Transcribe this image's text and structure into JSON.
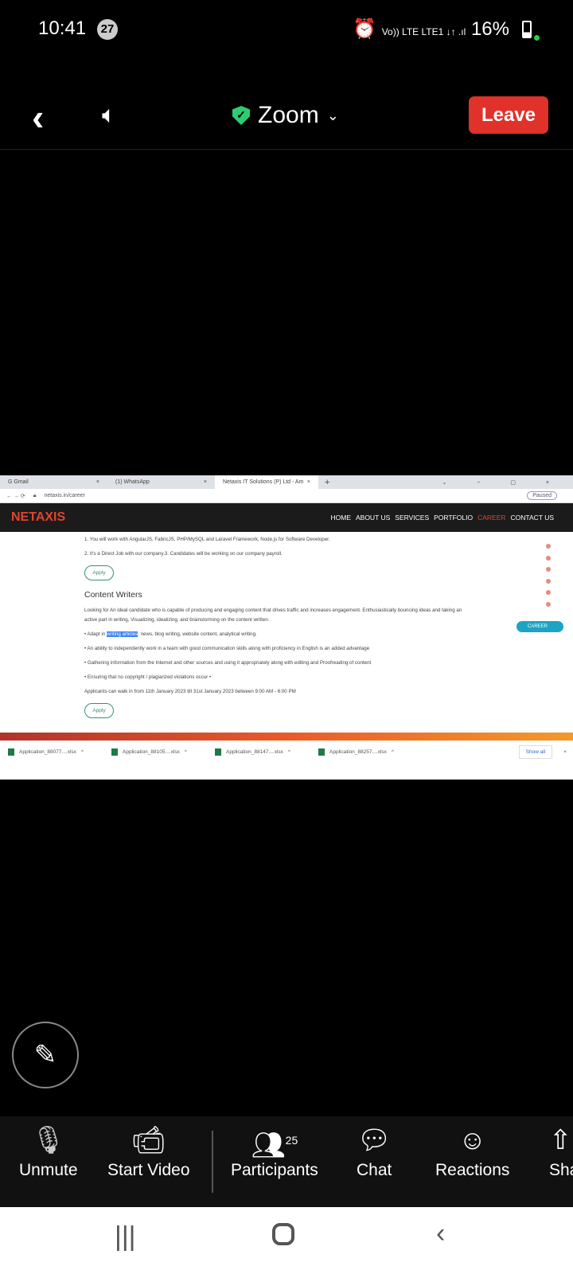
{
  "status": {
    "time": "10:41",
    "notif_count": "27",
    "net": "Vo)) LTE LTE1 ↓↑ .ıl",
    "battery": "16%"
  },
  "header": {
    "title": "Zoom",
    "leave": "Leave"
  },
  "browser": {
    "tabs": [
      {
        "label": "G  Gmail"
      },
      {
        "label": "(1) WhatsApp"
      },
      {
        "label": "Netaxis IT Solutions (P) Ltd - Am"
      }
    ],
    "url": "netaxis.in/career",
    "profile": "Paused",
    "site": {
      "logo": "NETAXIS",
      "nav": [
        "HOME",
        "ABOUT US",
        "SERVICES",
        "PORTFOLIO",
        "CAREER",
        "CONTACT US"
      ]
    },
    "content": {
      "line1": "1. You will work with AngularJS, FabricJS, PHP/MySQL and Laravel Framework, Node.js for Software Developer.",
      "line2": "2. It's a Direct Job with our company.3. Candidates will be working on our company payroll.",
      "apply": "Apply",
      "heading": "Content Writers",
      "desc1": "Looking for An ideal candidate who is capable of producing and engaging content that drives traffic and increases engagement. Enthusiastically bouncing ideas and taking an",
      "desc2": "active part in writing, Visualizing, idealizing, and brainstorming on the content written.",
      "b1_pre": "• Adapt in ",
      "b1_hl": "writing articles",
      "b1_post": ", news, blog writing, website content, analytical writing.",
      "b2": "• An ability to independently work in a team with good communication skills along with proficiency in English is an added advantage",
      "b3": "• Gathering information from the Internet and other sources and using it appropriately along with editing and Proofreading of content",
      "b4": "• Ensuring that no copyright / plagiarized violations occur •",
      "walkin": "Applicants can walk in from 11th January 2023 till 31st January 2023 between 9:00 AM - 6:00 PM",
      "career_pill": "CAREER"
    },
    "downloads": [
      "Application_88077....xlsx",
      "Application_88105....xlsx",
      "Application_88147....xlsx",
      "Application_88257....xlsx"
    ],
    "show_all": "Show all"
  },
  "toolbar": {
    "unmute": "Unmute",
    "video": "Start Video",
    "participants": "Participants",
    "participant_count": "25",
    "chat": "Chat",
    "reactions": "Reactions",
    "share": "Share"
  }
}
